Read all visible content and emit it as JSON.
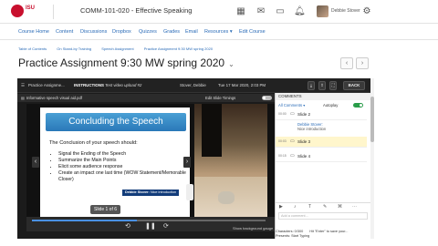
{
  "header": {
    "logo_text": "ISU",
    "course_title": "COMM-101-020 - Effective Speaking",
    "user_name": "Debbie Stover",
    "icons": [
      "grid-icon",
      "mail-icon",
      "chat-icon",
      "bell-icon",
      "gear-icon"
    ]
  },
  "nav": {
    "items": [
      "Course Home",
      "Content",
      "Discussions",
      "Dropbox",
      "Quizzes",
      "Grades",
      "Email",
      "Resources ▾",
      "Edit Course"
    ]
  },
  "breadcrumbs": [
    "Table of Contents",
    "On Stand-by Training",
    "Speech Assignment",
    "Practice Assignment 9:30 MW spring 2020"
  ],
  "page": {
    "title": "Practice Assignment 9:30 MW spring 2020",
    "chevron": "⌄"
  },
  "viewer": {
    "assignment_label": "Practice Assignme...",
    "instructions_label": "INSTRUCTIONS",
    "upload_label": "Test video upload #2",
    "author": "Stover, Debbie",
    "date": "Tue 17 Mar 2020, 2:03 PM",
    "file_label": "Informative speech visual aid.pdf",
    "edit_timings_label": "Edit Slide Timings",
    "back_label": "BACK",
    "slide_num_label": "Slide 1 of 6",
    "show_bg_label": "Show background gauge",
    "progress": 0.45
  },
  "slide": {
    "title": "Concluding the Speech",
    "intro": "The Conclusion of your speech should:",
    "bullets": [
      "Signal the Ending of the Speech",
      "Summarize the Main Points",
      "Elicit some audience response",
      "Create an impact one last time (WOW Statement/Memorable Closer)"
    ],
    "badge_name": "Debbie Stover:",
    "badge_text": "Nice introduction"
  },
  "comments": {
    "header": "COMMENTS",
    "filter": "All Comments ▾",
    "autoplay": "Autoplay",
    "rows": [
      {
        "ts": "00:00",
        "label": "Slide 2"
      },
      {
        "ts": "00:03",
        "label": "Slide 3"
      },
      {
        "ts": "00:15",
        "label": "Slide 4"
      }
    ],
    "note_author": "Debbie Stover:",
    "note_text": "Nice introduction",
    "input_placeholder": "Add a comment...",
    "footer_line1": "Characters: 0/300",
    "footer_line2": "Presents: Start Typing",
    "footer_line3": "Hit \"Enter\" to save your..."
  }
}
